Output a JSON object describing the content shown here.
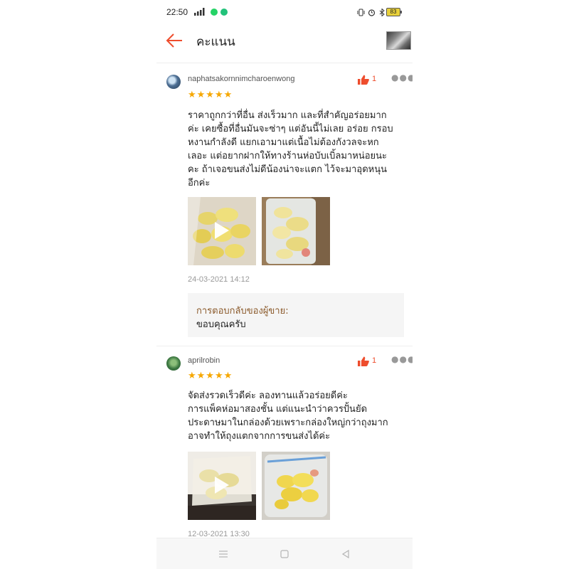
{
  "status_bar": {
    "time": "22:50",
    "battery": "83"
  },
  "header": {
    "title": "คะแนน"
  },
  "reviews": [
    {
      "username": "naphatsakornnimcharoenwong",
      "likes": "1",
      "stars": "★★★★★",
      "text_lines": [
        "ราคาถูกกว่าที่อื่น ส่งเร็วมาก และที่สำคัญอร่อยมาก",
        "ค่ะ เคยซื้อที่อื่นมันจะซ่าๆ แต่อันนี้ไม่เลย อร่อย กรอบ",
        "หงานกำลังดี แยกเอามาแต่เนื้อไม่ต้องกังวลจะหก",
        "เลอะ แต่อยากฝากให้ทางร้านห่อบับเบิ้ลมาหน่อยนะ",
        "คะ ถ้าเจอขนส่งไม่ดีน้องน่าจะแตก ไว้จะมาอุดหนุน",
        "อีกค่ะ"
      ],
      "date": "24-03-2021 14:12",
      "reply_label": "การตอบกลับของผู้ขาย:",
      "reply_text": "ขอบคุณครับ"
    },
    {
      "username": "aprilrobin",
      "likes": "1",
      "stars": "★★★★★",
      "text_lines": [
        "จัดส่งรวดเร็วดีค่ะ ลองทานแล้วอร่อยดีค่ะ",
        "การแพ็คห่อมาสองชั้น แต่แนะนำว่าควรปั้นยัด",
        "ประดาษมาในกล่องด้วยเพราะกล่องใหญ่กว่าถุงมาก",
        "อาจทำให้ถุงแตกจากการขนส่งได้ค่ะ"
      ],
      "date": "12-03-2021 13:30"
    }
  ],
  "icons": {
    "back": "arrow-left-icon",
    "like": "thumbs-up-icon",
    "more": "more-dots-icon",
    "play": "play-icon"
  },
  "colors": {
    "accent": "#ee4d2d",
    "star": "#f6a700",
    "reply_label": "#8b5a2b"
  }
}
